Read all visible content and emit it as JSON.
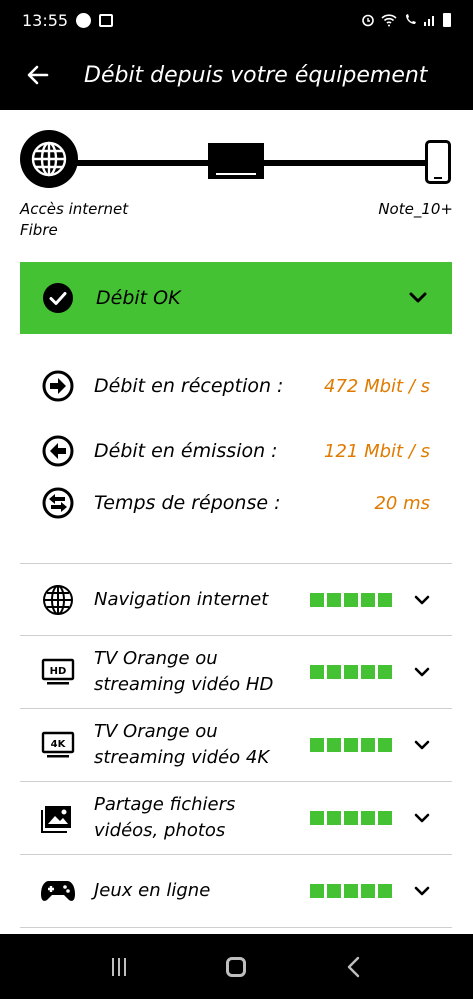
{
  "status_bar": {
    "time": "13:55"
  },
  "app_bar": {
    "title": "Débit depuis votre équipement",
    "back_icon": "arrow-left-icon"
  },
  "connection": {
    "left_label_line1": "Accès internet",
    "left_label_line2": "Fibre",
    "right_label": "Note_10+"
  },
  "status_banner": {
    "label": "Débit OK",
    "color": "#45c234"
  },
  "metrics": [
    {
      "label": "Débit en réception :",
      "value": "472 Mbit / s",
      "icon": "arrow-right-circle-icon"
    },
    {
      "label": "Débit en émission :",
      "value": "121 Mbit / s",
      "icon": "arrow-left-circle-icon"
    },
    {
      "label": "Temps de réponse :",
      "value": "20 ms",
      "icon": "swap-circle-icon"
    }
  ],
  "metric_value_color": "#e07b00",
  "usages": [
    {
      "label": "Navigation internet",
      "icon": "globe-icon",
      "level_filled": 5,
      "level_max": 5
    },
    {
      "label": "TV Orange ou streaming vidéo HD",
      "icon": "tv-hd-icon",
      "icon_text": "HD",
      "level_filled": 5,
      "level_max": 5
    },
    {
      "label": "TV Orange ou streaming vidéo 4K",
      "icon": "tv-4k-icon",
      "icon_text": "4K",
      "level_filled": 5,
      "level_max": 5
    },
    {
      "label": "Partage fichiers vidéos, photos",
      "icon": "image-icon",
      "level_filled": 5,
      "level_max": 5
    },
    {
      "label": "Jeux en ligne",
      "icon": "gamepad-icon",
      "level_filled": 5,
      "level_max": 5
    }
  ]
}
